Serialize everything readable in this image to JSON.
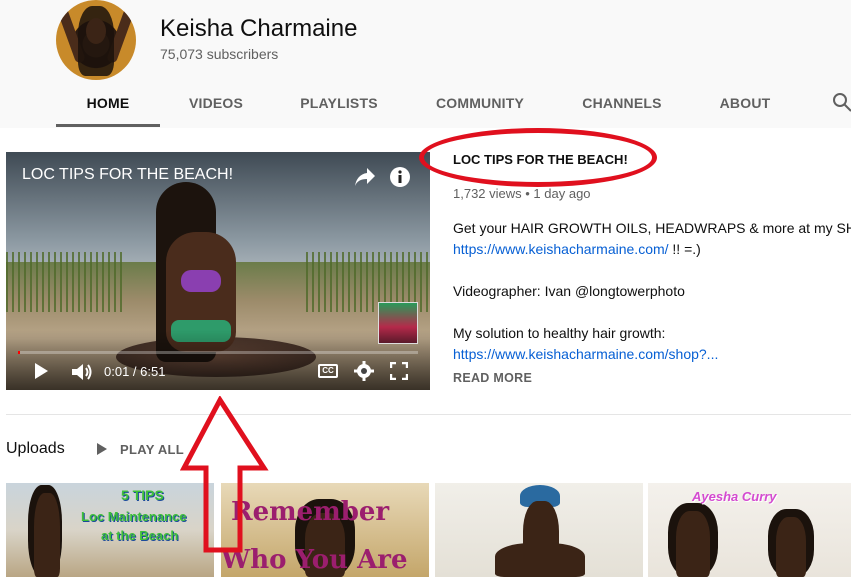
{
  "channel": {
    "name": "Keisha Charmaine",
    "subscribers": "75,073 subscribers"
  },
  "tabs": [
    {
      "label": "HOME",
      "active": true
    },
    {
      "label": "VIDEOS",
      "active": false
    },
    {
      "label": "PLAYLISTS",
      "active": false
    },
    {
      "label": "COMMUNITY",
      "active": false
    },
    {
      "label": "CHANNELS",
      "active": false
    },
    {
      "label": "ABOUT",
      "active": false
    }
  ],
  "player": {
    "overlay_title": "LOC TIPS FOR THE BEACH!",
    "time": "0:01 / 6:51",
    "cc_label": "CC",
    "progress_fraction": 0.0024
  },
  "featured": {
    "title": "LOC TIPS FOR THE BEACH!",
    "meta": "1,732 views • 1 day ago",
    "desc_line1": "Get your HAIR GROWTH OILS, HEADWRAPS & more at my SHOP,",
    "desc_link1": "https://www.keishacharmaine.com/",
    "desc_link1_suffix": " !! =.)",
    "desc_line2": "Videographer: Ivan @longtowerphoto",
    "desc_line3": "My solution to healthy hair growth:",
    "desc_link2": "https://www.keishacharmaine.com/shop?...",
    "read_more": "READ MORE"
  },
  "uploads": {
    "heading": "Uploads",
    "play_all": "PLAY ALL",
    "thumbnails": [
      {
        "lines": [
          "5 TIPS",
          "Loc Maintenance",
          "at the Beach"
        ]
      },
      {
        "lines": [
          "Remember",
          "Who You Are"
        ]
      },
      {
        "lines": []
      },
      {
        "lines": [
          "Ayesha Curry"
        ]
      }
    ]
  },
  "annotation_colors": {
    "circle": "#e0101e",
    "arrow": "#e0101e"
  },
  "icons": [
    "search-icon",
    "share-icon",
    "info-icon",
    "play-icon",
    "volume-icon",
    "settings-icon",
    "fullscreen-icon",
    "play-all-icon"
  ]
}
